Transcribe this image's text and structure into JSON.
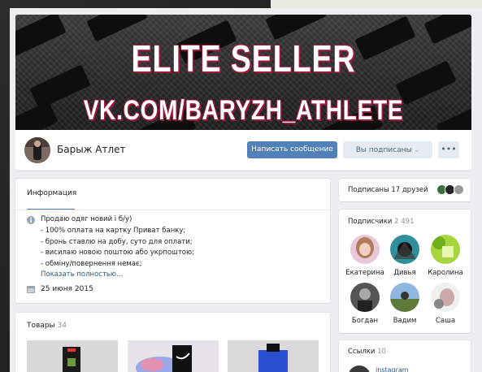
{
  "cover": {
    "line1": "ELITE SELLER",
    "line2": "VK.COM/BARYZH_ATHLETE"
  },
  "profile": {
    "name": "Барыж Атлет",
    "write_message": "Написать сообщение",
    "subscribed": "Вы подписаны",
    "subscribed_chevron": "⌄",
    "more": "•••"
  },
  "info": {
    "tab": "Информация",
    "lines": [
      "Продаю одяг новий і б/у)",
      "- 100% оплата на картку Приват банку;",
      "- бронь ставлю на добу, суто для оплати;",
      "- висилаю новою поштою або укрпоштою;",
      "- обміну/повернення немає;"
    ],
    "show_more": "Показать полностью...",
    "date": "25 июня 2015"
  },
  "products": {
    "title": "Товары",
    "count": "34"
  },
  "friends": {
    "title": "Подписаны 17 друзей"
  },
  "followers": {
    "title": "Подписчики",
    "count": "2 491",
    "items": [
      {
        "name": "Екатерина"
      },
      {
        "name": "Дивья"
      },
      {
        "name": "Каролина"
      },
      {
        "name": "Богдан"
      },
      {
        "name": "Вадим"
      },
      {
        "name": "Саша"
      }
    ]
  },
  "links": {
    "title": "Ссылки",
    "count": "10",
    "first": "instagram"
  },
  "colors": {
    "accent": "#5181b8",
    "link": "#2a5885",
    "page_bg": "#edeef0",
    "cover_text_shadow": "#a0183a"
  }
}
